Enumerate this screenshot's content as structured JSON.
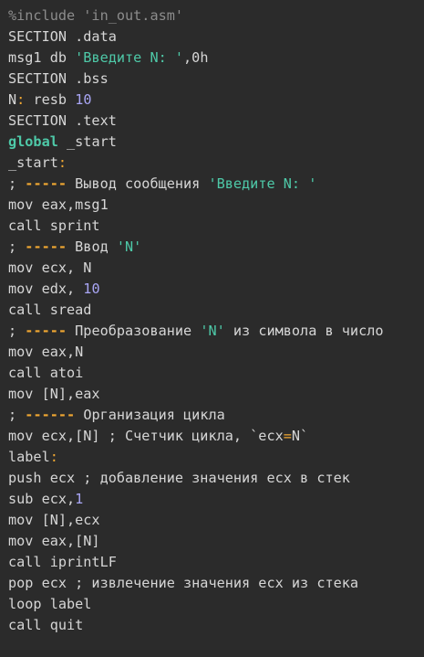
{
  "colors": {
    "background": "#2b2b2b",
    "text": "#d6d6d6",
    "preproc": "#8c8c8c",
    "string": "#4ec9a8",
    "number": "#a9a6f5",
    "keyword": "#4ec9a8",
    "punct": "#f0a732"
  },
  "code": {
    "lines": [
      [
        {
          "t": "%include 'in_out.asm'",
          "c": "preproc"
        }
      ],
      [
        {
          "t": "SECTION .data",
          "c": "plain"
        }
      ],
      [
        {
          "t": "msg1 db ",
          "c": "plain"
        },
        {
          "t": "'Введите N: '",
          "c": "string"
        },
        {
          "t": ",0h",
          "c": "plain"
        }
      ],
      [
        {
          "t": "SECTION .bss",
          "c": "plain"
        }
      ],
      [
        {
          "t": "N",
          "c": "plain"
        },
        {
          "t": ":",
          "c": "punct"
        },
        {
          "t": " resb ",
          "c": "plain"
        },
        {
          "t": "10",
          "c": "number"
        }
      ],
      [
        {
          "t": "SECTION .text",
          "c": "plain"
        }
      ],
      [
        {
          "t": "global",
          "c": "keyword"
        },
        {
          "t": " _start",
          "c": "plain"
        }
      ],
      [
        {
          "t": "_start",
          "c": "plain"
        },
        {
          "t": ":",
          "c": "punct"
        }
      ],
      [
        {
          "t": "; ",
          "c": "comment"
        },
        {
          "t": "-----",
          "c": "dash"
        },
        {
          "t": " Вывод сообщения ",
          "c": "comment"
        },
        {
          "t": "'Введите N: '",
          "c": "string"
        }
      ],
      [
        {
          "t": "mov eax,msg1",
          "c": "plain"
        }
      ],
      [
        {
          "t": "call sprint",
          "c": "plain"
        }
      ],
      [
        {
          "t": "; ",
          "c": "comment"
        },
        {
          "t": "-----",
          "c": "dash"
        },
        {
          "t": " Ввод ",
          "c": "comment"
        },
        {
          "t": "'N'",
          "c": "string"
        }
      ],
      [
        {
          "t": "mov ecx, N",
          "c": "plain"
        }
      ],
      [
        {
          "t": "mov edx, ",
          "c": "plain"
        },
        {
          "t": "10",
          "c": "number"
        }
      ],
      [
        {
          "t": "call sread",
          "c": "plain"
        }
      ],
      [
        {
          "t": "; ",
          "c": "comment"
        },
        {
          "t": "-----",
          "c": "dash"
        },
        {
          "t": " Преобразование ",
          "c": "comment"
        },
        {
          "t": "'N'",
          "c": "string"
        },
        {
          "t": " из символа в число",
          "c": "comment"
        }
      ],
      [
        {
          "t": "mov eax,N",
          "c": "plain"
        }
      ],
      [
        {
          "t": "call atoi",
          "c": "plain"
        }
      ],
      [
        {
          "t": "mov [N],eax",
          "c": "plain"
        }
      ],
      [
        {
          "t": "; ",
          "c": "comment"
        },
        {
          "t": "------",
          "c": "dash"
        },
        {
          "t": " Организация цикла",
          "c": "comment"
        }
      ],
      [
        {
          "t": "mov ecx,[N] ; Счетчик цикла, `ecx",
          "c": "plain"
        },
        {
          "t": "=",
          "c": "punct"
        },
        {
          "t": "N`",
          "c": "plain"
        }
      ],
      [
        {
          "t": "label",
          "c": "plain"
        },
        {
          "t": ":",
          "c": "punct"
        }
      ],
      [
        {
          "t": "push ecx ; добавление значения ecx в стек",
          "c": "plain"
        }
      ],
      [
        {
          "t": "sub ecx,",
          "c": "plain"
        },
        {
          "t": "1",
          "c": "number"
        }
      ],
      [
        {
          "t": "mov [N],ecx",
          "c": "plain"
        }
      ],
      [
        {
          "t": "mov eax,[N]",
          "c": "plain"
        }
      ],
      [
        {
          "t": "call iprintLF",
          "c": "plain"
        }
      ],
      [
        {
          "t": "pop ecx ; извлечение значения ecx из стека",
          "c": "plain"
        }
      ],
      [
        {
          "t": "loop label",
          "c": "plain"
        }
      ],
      [
        {
          "t": "call quit",
          "c": "plain"
        }
      ]
    ]
  }
}
